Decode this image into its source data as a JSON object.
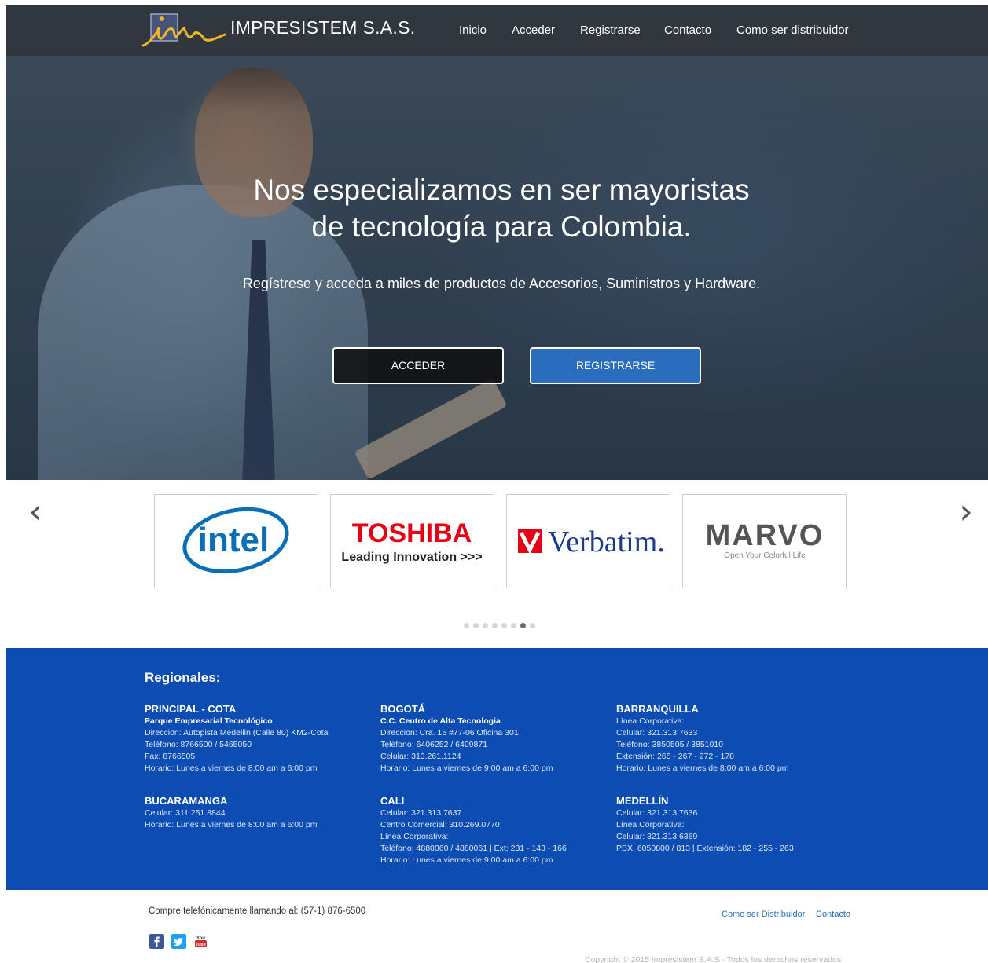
{
  "header": {
    "brand": "IMPRESISTEM S.A.S.",
    "nav": [
      "Inicio",
      "Acceder",
      "Registrarse",
      "Contacto",
      "Como ser distribuidor"
    ]
  },
  "hero": {
    "title_line1": "Nos especializamos en ser mayoristas",
    "title_line2": "de tecnología para Colombia.",
    "subtitle": "Regístrese y acceda a miles de productos de Accesorios, Suministros y Hardware.",
    "btn_acceder": "ACCEDER",
    "btn_registrarse": "REGISTRARSE"
  },
  "brands": {
    "items": [
      {
        "name": "intel",
        "logo_text": "intel"
      },
      {
        "name": "toshiba",
        "logo_text": "TOSHIBA",
        "tagline": "Leading Innovation >>>"
      },
      {
        "name": "verbatim",
        "logo_text": "Verbatim."
      },
      {
        "name": "marvo",
        "logo_text": "MARVO",
        "tagline": "Open Your Colorful Life"
      }
    ],
    "dots_total": 8,
    "dots_active_index": 6,
    "colors": {
      "intel": "#0b6fb8",
      "toshiba": "#e60012",
      "verbatim": "#1a3a8f",
      "marvo": "#555555"
    }
  },
  "regionales": {
    "title": "Regionales:",
    "offices": [
      {
        "name": "PRINCIPAL - COTA",
        "lines": [
          "Parque Empresarial Tecnológico",
          "Direccion: Autopista Medellin (Calle 80) KM2-Cota",
          "Teléfono: 8766500 / 5465050",
          "Fax: 8766505",
          "Horario: Lunes a viernes de 8:00 am a 6:00 pm"
        ]
      },
      {
        "name": "BOGOTÁ",
        "lines": [
          "C.C. Centro de Alta Tecnologia",
          "Direccion: Cra. 15 #77-06 Oficina 301",
          "Teléfono: 6406252 / 6409871",
          "Celular: 313.261.1124",
          "Horario: Lunes a viernes de 9:00 am a 6:00 pm"
        ]
      },
      {
        "name": "BARRANQUILLA",
        "lines": [
          "Línea Corporativa:",
          "Celular: 321.313.7633",
          "Teléfono: 3850505 / 3851010",
          "Extensión: 265 - 267 - 272 - 178",
          "Horario: Lunes a viernes de 8:00 am a 6:00 pm"
        ]
      },
      {
        "name": "BUCARAMANGA",
        "lines": [
          "Celular: 311.251.8844",
          "Horario: Lunes a viernes de 8:00 am a 6:00 pm"
        ]
      },
      {
        "name": "CALI",
        "lines": [
          "Celular: 321.313.7637",
          "Centro Comercial: 310.269.0770",
          "Línea Corporativa:",
          "Teléfono: 4880060 / 4880061 | Ext: 231 - 143 - 166",
          "Horario: Lunes a viernes de 9:00 am a 6:00 pm"
        ]
      },
      {
        "name": "MEDELLÍN",
        "lines": [
          "Celular: 321.313.7636",
          "Línea Corporativa:",
          "Celular: 321.313.6369",
          "PBX: 6050800 / 813 | Extensión: 182 - 255 - 263"
        ]
      }
    ]
  },
  "footer": {
    "phone": "Compre telefónicamente llamando al: (57-1) 876-6500",
    "links": [
      "Como ser Distribuidor",
      "Contacto"
    ],
    "social": [
      "facebook-icon",
      "twitter-icon",
      "youtube-icon"
    ],
    "copyright": "Copyright © 2015 Impresistem S.A.S - Todos los derechos reservados"
  }
}
